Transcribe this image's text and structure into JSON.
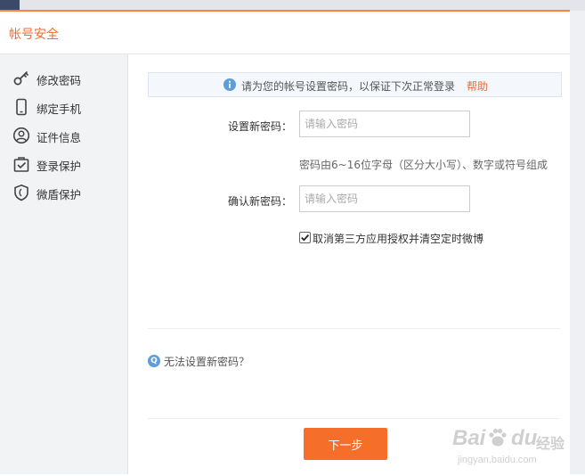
{
  "header": {
    "title": "帐号安全"
  },
  "sidebar": {
    "items": [
      {
        "label": "修改密码",
        "icon": "key-icon"
      },
      {
        "label": "绑定手机",
        "icon": "phone-icon"
      },
      {
        "label": "证件信息",
        "icon": "id-card-icon"
      },
      {
        "label": "登录保护",
        "icon": "login-protect-icon"
      },
      {
        "label": "微盾保护",
        "icon": "shield-icon"
      }
    ]
  },
  "notice": {
    "text": "请为您的帐号设置密码，以保证下次正常登录",
    "help_label": "帮助"
  },
  "form": {
    "new_password_label": "设置新密码：",
    "new_password_placeholder": "请输入密码",
    "password_hint": "密码由6~16位字母（区分大小写）、数字或符号组成",
    "confirm_password_label": "确认新密码：",
    "confirm_password_placeholder": "请输入密码",
    "revoke_checkbox_label": "取消第三方应用授权并清空定时微博",
    "revoke_checked": true
  },
  "footer": {
    "cant_set_text": "无法设置新密码？",
    "next_button_label": "下一步"
  },
  "watermark": {
    "brand_left": "Bai",
    "brand_right": "du",
    "brand_cn": "经验",
    "url": "jingyan.baidu.com"
  },
  "colors": {
    "accent": "#f06c32",
    "button": "#f56e2a",
    "info_blue": "#5e9ddb",
    "sidebar_bg": "#f2f3f5"
  }
}
